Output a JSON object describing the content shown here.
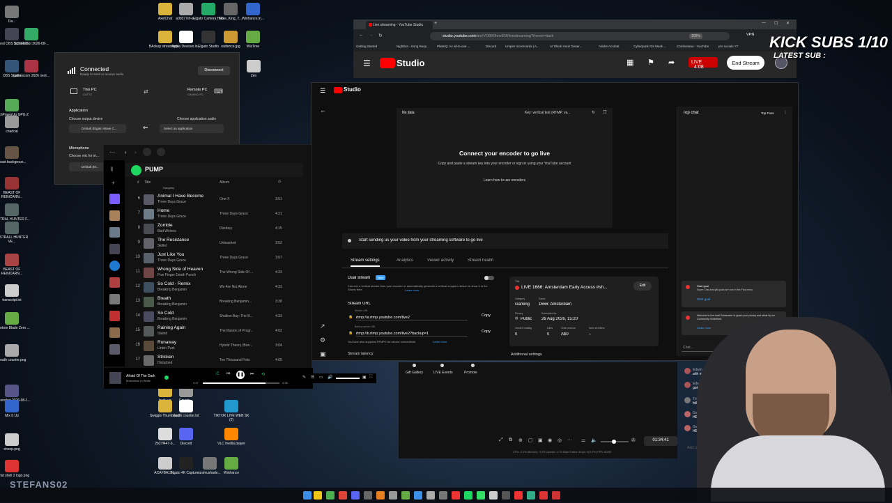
{
  "desktop": {
    "icons_left": [
      "Da...",
      "Latest OBS SCENES",
      "Screenshot 2026-08-...",
      "OBS Studio",
      "gamescom 2026 next...",
      "TechPowerUp GPU-Z",
      "chadcat",
      "beast backgroun...",
      "BEAST OF REINCARN...",
      "MISTRAL HUNTER F...",
      "MISTRALL HUNTER VE...",
      "BEAST OF REINCARN...",
      "transcript.txt",
      "Phantom Blade Zero ...",
      "Death counter.png",
      "Screenshot 2026-08-1...",
      "Mix It Up",
      "sheep.png",
      "mortal shell 2 logo.png"
    ],
    "icons_top": [
      "AxelChat",
      "add377ef-e...",
      "Elgato Camera Hub",
      "Rise_King_T...",
      "Winhance.In...",
      "BAckup streamer.b...",
      "Apple Devices.ln...",
      "Elgato Studio",
      "radience.jpg",
      "WizTree",
      "Zen"
    ],
    "icons_bottom": [
      "back up",
      "Counte...",
      "Swiggis Thumbnails",
      "death counter.txt",
      "TIKTOK LIVE WEB SK (2)",
      "2b27f447-3...",
      "Discord",
      "VLC media player",
      "ACAFBA12-...",
      "Elgato 4K Capture...",
      "onimushade...",
      "Winhance"
    ],
    "watermark": "STEFANS02"
  },
  "overlay": {
    "subs": "KICK SUBS 1/10",
    "latest": "LATEST SUB :"
  },
  "audio_panel": {
    "status": "Connected",
    "status_sub": "Ready to send or receive audio",
    "disconnect": "Disconnect",
    "this_pc": "This PC",
    "this_pc_sub": "GATTO",
    "remote_pc": "Remote PC",
    "remote_pc_sub": "GAMING PC",
    "application": "Application",
    "choose_output": "Choose output device",
    "choose_app_audio": "Choose application audio",
    "output_value": "Default (Elgato Wave C...",
    "select_app": "Select an application",
    "microphone": "Microphone",
    "choose_mic": "Choose mic for in...",
    "mic_value": "Default (M..."
  },
  "spotify": {
    "playlist": "PUMP",
    "col_title": "Title",
    "col_album": "Album",
    "partial_top_artist": "Daughtry",
    "tracks": [
      {
        "n": "6",
        "title": "Animal I Have Become",
        "artist": "Three Days Grace",
        "album": "One-X",
        "dur": "3:51"
      },
      {
        "n": "7",
        "title": "Home",
        "artist": "Three Days Grace",
        "album": "Three Days Grace",
        "dur": "4:21"
      },
      {
        "n": "8",
        "title": "Zombie",
        "artist": "Bad Wolves",
        "album": "Disobey",
        "dur": "4:15"
      },
      {
        "n": "9",
        "title": "The Resistance",
        "artist": "Skillet",
        "album": "Unleashed",
        "dur": "3:52"
      },
      {
        "n": "10",
        "title": "Just Like You",
        "artist": "Three Days Grace",
        "album": "Three Days Grace",
        "dur": "3:07"
      },
      {
        "n": "11",
        "title": "Wrong Side of Heaven",
        "artist": "Five Finger Death Punch",
        "album": "The Wrong Side Of ...",
        "dur": "4:33"
      },
      {
        "n": "12",
        "title": "So Cold - Remix",
        "artist": "Breaking Benjamin",
        "album": "We Are Not Alone",
        "dur": "4:33"
      },
      {
        "n": "13",
        "title": "Breath",
        "artist": "Breaking Benjamin",
        "album": "Breaking Benjamin...",
        "dur": "3:38"
      },
      {
        "n": "14",
        "title": "So Cold",
        "artist": "Breaking Benjamin",
        "album": "Shallow Bay: The B...",
        "dur": "4:33"
      },
      {
        "n": "15",
        "title": "Raining Again",
        "artist": "Staind",
        "album": "The Illusion of Progr...",
        "dur": "4:02"
      },
      {
        "n": "16",
        "title": "Runaway",
        "artist": "Linkin Park",
        "album": "Hybrid Theory (Bon...",
        "dur": "3:04"
      },
      {
        "n": "17",
        "title": "Stricken",
        "artist": "Disturbed",
        "album": "Ten Thousand Fists",
        "dur": "4:05"
      }
    ],
    "now_playing_title": "Afraid Of The Dark",
    "now_playing_artist": "Motionless In White",
    "elapsed": "3:47",
    "total": "4:38",
    "progress": 0.82
  },
  "browser": {
    "tab_title": "Live streaming - YouTube Studio",
    "url_host": "studio.youtube.com",
    "url_path": "/video/VO8K0hnvEM/livestreaming?theme=dark",
    "zoom": "100%",
    "vpn": "VPN",
    "bookmarks": [
      "Getting Started",
      "Nightbot - Song Requ...",
      "PlateIQ: An all-in-one ...",
      "Discord",
      "Umpire Scorecards | A...",
      "AI Tiktok Hook Gener...",
      "Adobe Acrobat",
      "Cyberpunk Oni Mask ...",
      "Cambonano - YouTube",
      "pro socials YT"
    ],
    "studio_logo": "Studio",
    "live_badge": "LIVE",
    "live_time": "4:08",
    "end_stream": "End Stream"
  },
  "studio": {
    "logo": "Studio",
    "no_data": "No data",
    "key": "Key: vertical test (RTMP, va...",
    "connect_title": "Connect your encoder to go live",
    "connect_sub": "Copy and paste a stream key into your encoder or sign in using your YouTube account",
    "learn_btn": "Learn how to use encoders",
    "start_sending": "Start sending us your video from your streaming software to go live",
    "tabs": [
      "Stream settings",
      "Analytics",
      "Viewer activity",
      "Stream health"
    ],
    "dual_stream": "Dual stream",
    "new_badge": "New",
    "dual_desc": "Connect a vertical stream from your encoder or automatically generate a vertical cropped version to show it in the Shorts feed.",
    "learn_more": "Learn more",
    "stream_url_label": "Stream URL",
    "stream_url_sub": "Stream URL",
    "stream_url": "rtmp://a.rtmp.youtube.com/live2",
    "backup_label": "Backup server URL",
    "backup_url": "rtmp://b.rtmp.youtube.com/live2?backup=1",
    "copy": "Copy",
    "rtmps_note": "YouTube also supports RTMPS for secure connections.",
    "stream_latency": "Stream latency",
    "additional": "Additional settings",
    "card_title_label": "Title",
    "card_title": "LIVE 1666: Amsterdam Early Access #sh...",
    "edit": "Edit",
    "category_label": "Category",
    "category": "Gaming",
    "game_label": "Game",
    "game": "1666: Amsterdam",
    "privacy_label": "Privacy",
    "privacy": "Public",
    "scheduled_label": "Scheduled for",
    "scheduled": "26 Aug 2026, 15:20",
    "viewers_label": "Viewers waiting",
    "viewers": "0",
    "likes_label": "Likes",
    "likes": "0",
    "revenue_label": "Chat revenue",
    "revenue": "A$0",
    "members_label": "New members",
    "members": "–",
    "top_chat": "Top chat",
    "top_fans": "Top Fans",
    "start_goal_title": "Start goal",
    "start_goal_desc": "Super Chat and gift goals are now in the Plus menu",
    "start_goal_link": "Start goal",
    "welcome": "Welcome to live chat! Remember to guard your privacy and abide by our Community Guidelines.",
    "chat_learn": "Learn more",
    "chat_placeholder": "Chat..."
  },
  "bottom_dock": {
    "items": [
      "Gift Gallery",
      "LIVE Events",
      "Promote"
    ],
    "timer": "01:34:41",
    "stats": "CPU: 3.1%   Memory: 0.4%   Upload: 4.79 kbps   Frame drops: 0(0.0%)   FPS: 60/60"
  },
  "chat_feed": [
    {
      "name": "Edwin",
      "msg": "ahh man"
    },
    {
      "name": "Edwin",
      "msg": "gotcha gotcha"
    },
    {
      "name": "Tristan Carpenter",
      "msg": "follow creator"
    },
    {
      "name": "Gatto",
      "msg": "HELLO"
    },
    {
      "name": "Gatto",
      "msg": "HELLLLO ARE"
    }
  ],
  "chat_add": "Add comment..."
}
